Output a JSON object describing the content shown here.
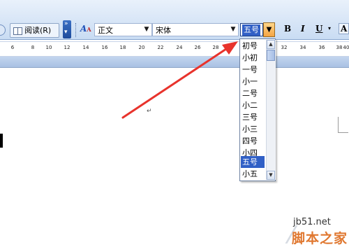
{
  "toolbar": {
    "read_button_label": "阅读(R)",
    "style_combo_value": "正文",
    "font_combo_value": "宋体",
    "font_size_value": "五号",
    "bold_label": "B",
    "italic_label": "I",
    "underline_label": "U",
    "font_color_label": "A"
  },
  "ruler": {
    "ticks": [
      "6",
      "8",
      "10",
      "12",
      "14",
      "16",
      "18",
      "20",
      "22",
      "24",
      "26",
      "28",
      "32",
      "34",
      "36",
      "38",
      "40"
    ]
  },
  "font_size_dropdown": {
    "options": [
      "初号",
      "小初",
      "一号",
      "小一",
      "二号",
      "小二",
      "三号",
      "小三",
      "四号",
      "小四",
      "五号",
      "小五"
    ],
    "selected": "五号"
  },
  "document": {
    "paragraph_mark": "↵"
  },
  "watermark": {
    "url": "jb51.net",
    "brand": "脚本之家"
  },
  "colors": {
    "selection": "#3160c6",
    "annotation_arrow": "#e8332c",
    "dropdown_button": "#f5a443"
  },
  "icons": [
    "book-icon",
    "style-icon",
    "dropdown-arrow-icon",
    "scroll-up-icon",
    "scroll-down-icon"
  ]
}
